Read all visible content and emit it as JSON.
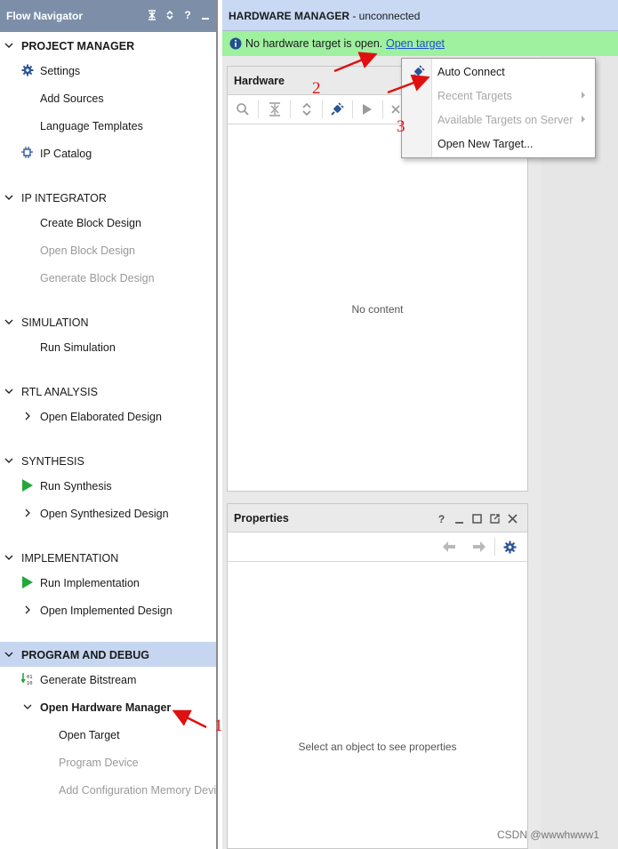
{
  "flow_navigator": {
    "title": "Flow Navigator",
    "header_icons": [
      "collapse-all-icon",
      "expand-icon",
      "help-icon",
      "minimize-icon"
    ],
    "sections": [
      {
        "label": "PROJECT MANAGER",
        "items": [
          {
            "label": "Settings",
            "icon": "gear-icon"
          },
          {
            "label": "Add Sources"
          },
          {
            "label": "Language Templates"
          },
          {
            "label": "IP Catalog",
            "icon": "ip-catalog-icon"
          }
        ]
      },
      {
        "label": "IP INTEGRATOR",
        "items": [
          {
            "label": "Create Block Design"
          },
          {
            "label": "Open Block Design",
            "disabled": true
          },
          {
            "label": "Generate Block Design",
            "disabled": true
          }
        ]
      },
      {
        "label": "SIMULATION",
        "items": [
          {
            "label": "Run Simulation"
          }
        ]
      },
      {
        "label": "RTL ANALYSIS",
        "items": [
          {
            "label": "Open Elaborated Design"
          }
        ]
      },
      {
        "label": "SYNTHESIS",
        "items": [
          {
            "label": "Run Synthesis",
            "icon": "play-icon"
          },
          {
            "label": "Open Synthesized Design"
          }
        ]
      },
      {
        "label": "IMPLEMENTATION",
        "items": [
          {
            "label": "Run Implementation",
            "icon": "play-icon"
          },
          {
            "label": "Open Implemented Design"
          }
        ]
      },
      {
        "label": "PROGRAM AND DEBUG",
        "items": [
          {
            "label": "Generate Bitstream",
            "icon": "bitstream-icon"
          },
          {
            "label": "Open Hardware Manager"
          },
          {
            "label": "Open Target"
          },
          {
            "label": "Program Device",
            "disabled": true
          },
          {
            "label": "Add Configuration Memory Device",
            "disabled": true
          }
        ]
      }
    ]
  },
  "hardware_manager": {
    "title_bold": "HARDWARE MANAGER",
    "title_rest": " - unconnected",
    "banner": {
      "message": "No hardware target is open.",
      "link": "Open target"
    }
  },
  "hardware_panel": {
    "title": "Hardware",
    "toolbar_icons": [
      "search-icon",
      "collapse-all-icon",
      "expand-all-icon",
      "auto-connect-icon",
      "run-icon",
      "close-icon"
    ],
    "empty_text": "No content"
  },
  "properties_panel": {
    "title": "Properties",
    "header_icons": [
      "help-icon",
      "minimize-icon",
      "maximize-icon",
      "float-icon",
      "close-icon"
    ],
    "toolbar_icons": [
      "back-icon",
      "forward-icon",
      "gear-icon"
    ],
    "empty_text": "Select an object to see properties"
  },
  "context_menu": {
    "items": [
      {
        "label": "Auto Connect",
        "icon": "auto-connect-icon"
      },
      {
        "label": "Recent Targets",
        "disabled": true,
        "submenu": true
      },
      {
        "label": "Available Targets on Server",
        "disabled": true,
        "submenu": true
      },
      {
        "label": "Open New Target..."
      }
    ]
  },
  "annotations": {
    "step1": "1",
    "step2": "2",
    "step3": "3",
    "color": "#e01010"
  },
  "watermark": "CSDN @wwwhwww1"
}
